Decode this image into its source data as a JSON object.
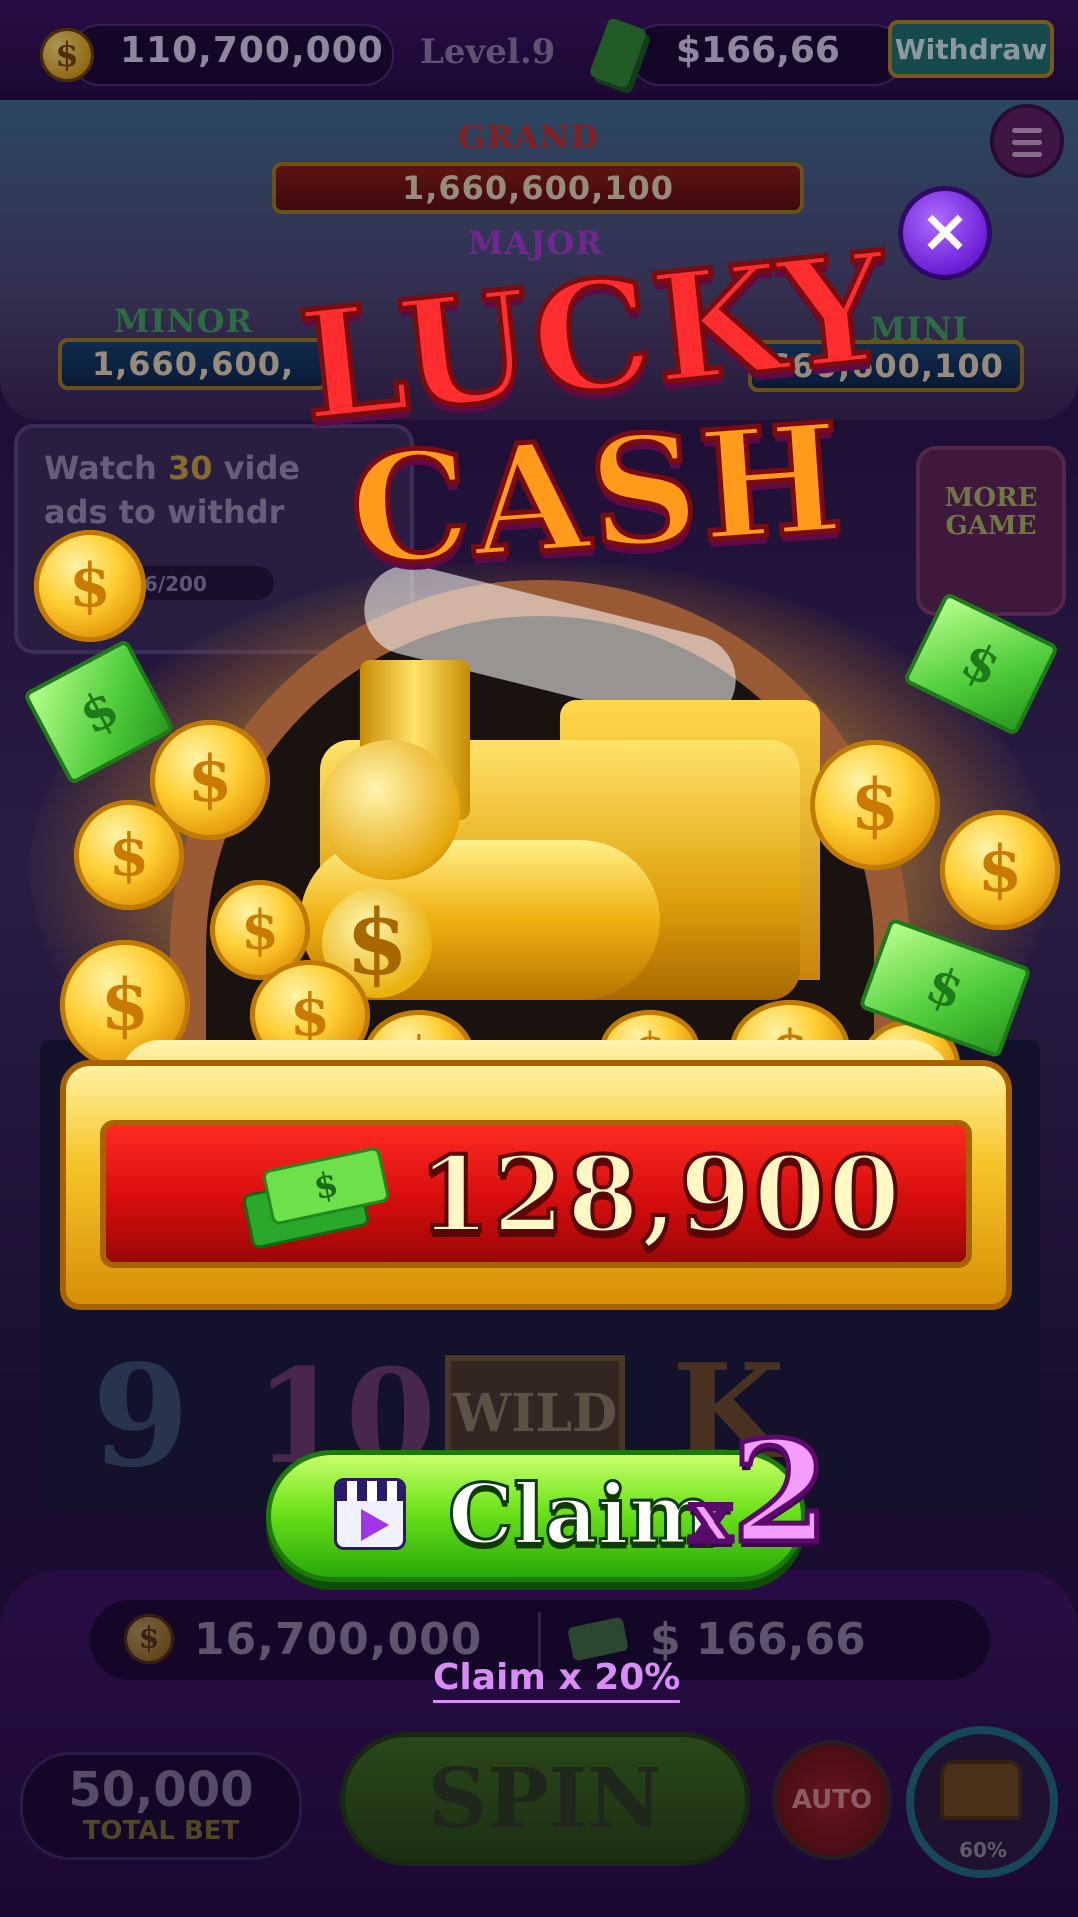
{
  "top_bar": {
    "coin_balance": "110,700,000",
    "level": "Level.9",
    "cash_balance": "$166,66",
    "withdraw_label": "Withdraw"
  },
  "jackpots": {
    "grand": {
      "label": "GRAND",
      "value": "1,660,600,100"
    },
    "major": {
      "label": "MAJOR"
    },
    "minor": {
      "label": "MINOR",
      "value": "1,660,600,"
    },
    "mini": {
      "label": "MINI",
      "value": "660,600,100"
    }
  },
  "video_ads": {
    "text_prefix": "Watch ",
    "count": "30",
    "text_mid": " vide",
    "text_line2": "ads to withdr",
    "progress": "66/200"
  },
  "more_game": {
    "label": "MORE GAME"
  },
  "reels": {
    "symbols": [
      "9",
      "10",
      "WILD",
      "K"
    ]
  },
  "bottom": {
    "coin_balance": "16,700,000",
    "cash_balance": "$ 166,66",
    "claim_percent_label": "Claim x 20%",
    "total_bet_value": "50,000",
    "total_bet_label": "TOTAL BET",
    "spin_label": "SPIN",
    "auto_label": "AUTO",
    "chest_progress": "60%"
  },
  "popup": {
    "title_line1": "LUCKY",
    "title_line2": "CASH",
    "reward_amount": "128,900",
    "claim_label": "Claim",
    "claim_multiplier_x": "x",
    "claim_multiplier_value": "2",
    "close_symbol": "×"
  },
  "colors": {
    "claim_button": "#6ee31a",
    "reward_bar": "#d40d0d",
    "gold": "#f7c52b",
    "close_button": "#6b1fd6"
  }
}
